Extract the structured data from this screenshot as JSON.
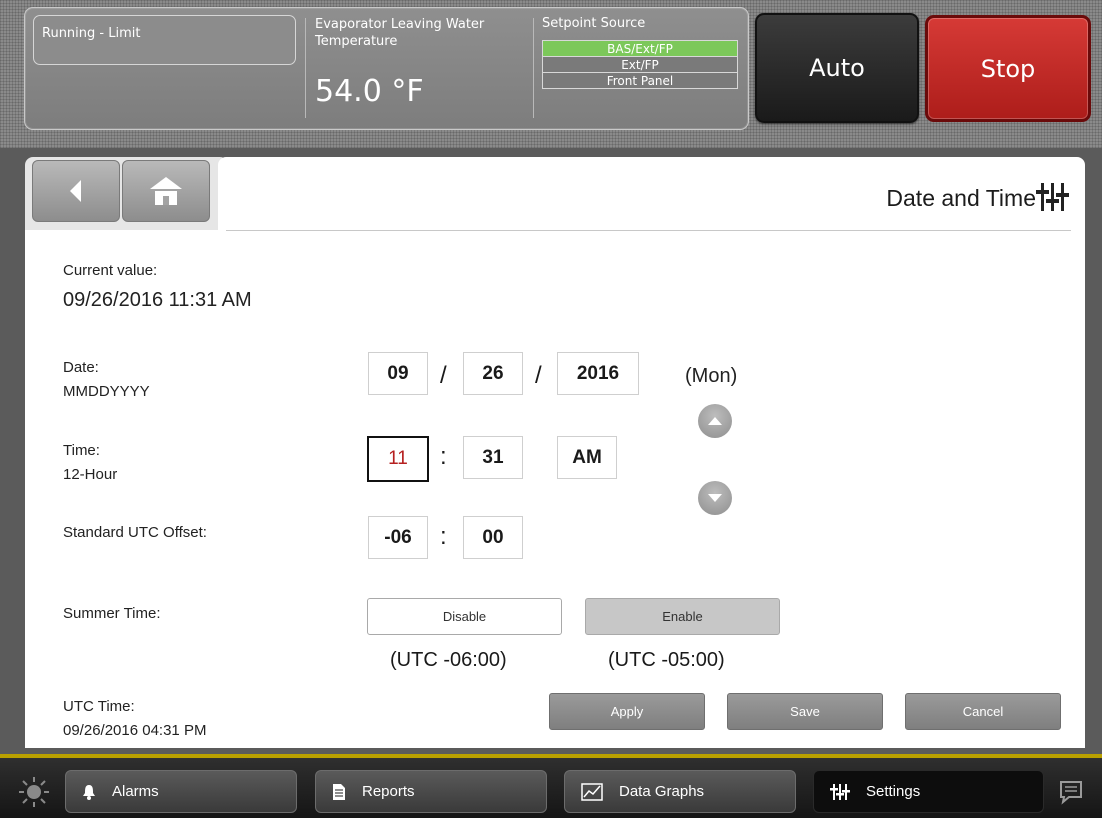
{
  "header": {
    "run_state": "Running - Limit",
    "evap_label": "Evaporator Leaving Water Temperature",
    "evap_value": "54.0 °F",
    "setpoint_label": "Setpoint Source",
    "setpoint_options": [
      "BAS/Ext/FP",
      "Ext/FP",
      "Front Panel"
    ],
    "setpoint_active": "BAS/Ext/FP",
    "auto_label": "Auto",
    "stop_label": "Stop"
  },
  "page": {
    "title": "Date and Time",
    "current_value_label": "Current value:",
    "current_value": "09/26/2016 11:31 AM"
  },
  "form": {
    "date_label": "Date:",
    "date_format": "MMDDYYYY",
    "month": "09",
    "day": "26",
    "year": "2016",
    "date_sep": "/",
    "weekday": "(Mon)",
    "time_label": "Time:",
    "time_format": "12-Hour",
    "hour": "11",
    "minute": "31",
    "ampm": "AM",
    "time_sep": ":",
    "utc_offset_label": "Standard UTC Offset:",
    "utc_offset_hours": "-06",
    "utc_offset_minutes": "00",
    "summer_time_label": "Summer Time:",
    "disable_label": "Disable",
    "enable_label": "Enable",
    "disable_sub": "(UTC -06:00)",
    "enable_sub": "(UTC -05:00)",
    "summer_time_selected": "Enable",
    "utc_time_label": "UTC Time:",
    "utc_time_value": "09/26/2016 04:31 PM"
  },
  "actions": {
    "apply": "Apply",
    "save": "Save",
    "cancel": "Cancel"
  },
  "bottom_nav": {
    "alarms": "Alarms",
    "reports": "Reports",
    "data_graphs": "Data Graphs",
    "settings": "Settings",
    "active": "Settings"
  },
  "colors": {
    "setpoint_active": "#7cc85a",
    "stop": "#c42b27",
    "selected_field_text": "#b52020",
    "accent_line": "#b9a000"
  },
  "icons": [
    "back-arrow-icon",
    "home-icon",
    "settings-sliders-icon",
    "up-arrow-icon",
    "down-arrow-icon",
    "sun-icon",
    "bell-icon",
    "document-icon",
    "graph-icon",
    "chat-icon"
  ]
}
